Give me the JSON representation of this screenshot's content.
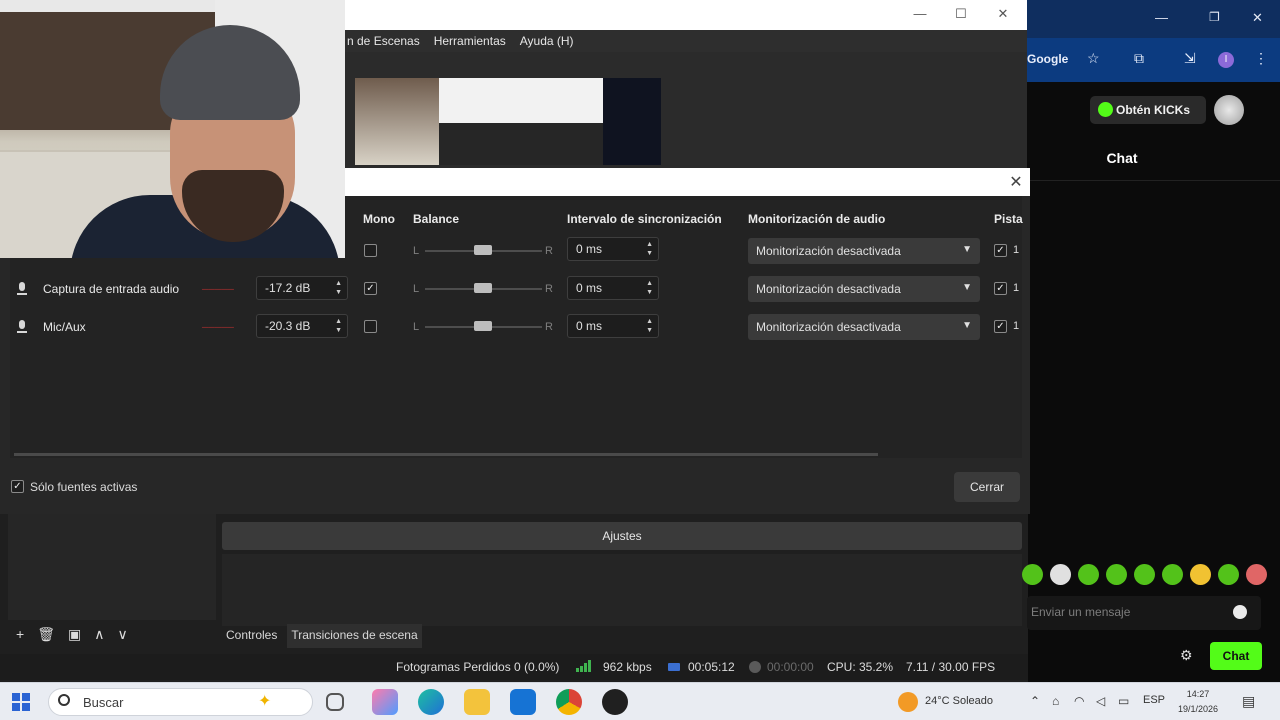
{
  "obs_main": {
    "menu": [
      "n de Escenas",
      "Herramientas",
      "Ayuda (H)"
    ],
    "window_buttons": {
      "minimize": "—",
      "maximize": "☐",
      "close": "✕"
    }
  },
  "dialog": {
    "close_glyph": "✕",
    "columns": {
      "mono": "Mono",
      "balance": "Balance",
      "sync": "Intervalo de sincronización",
      "monitoring": "Monitorización de audio",
      "tracks": "Pista"
    },
    "rows": [
      {
        "name": "",
        "volume": "",
        "mono": false,
        "sync": "0 ms",
        "monitoring": "Monitorización desactivada",
        "track": "1"
      },
      {
        "name": "Captura de entrada audio",
        "volume": "-17.2 dB",
        "mono": true,
        "sync": "0 ms",
        "monitoring": "Monitorización desactivada",
        "track": "1"
      },
      {
        "name": "Mic/Aux",
        "volume": "-20.3 dB",
        "mono": false,
        "sync": "0 ms",
        "monitoring": "Monitorización desactivada",
        "track": "1"
      }
    ],
    "balance_left": "L",
    "balance_right": "R",
    "active_only": "Sólo fuentes activas",
    "close_button": "Cerrar"
  },
  "dock": {
    "ajustes": "Ajustes",
    "tabs": [
      "Controles",
      "Transiciones de escena"
    ],
    "toolbar_icons": [
      "+",
      "🗑",
      "▣",
      "∧",
      "∨"
    ],
    "status": {
      "dropped": "Fotogramas Perdidos 0 (0.0%)",
      "bitrate": "962 kbps",
      "stream_time": "00:05:12",
      "rec_time": "00:00:00",
      "cpu": "CPU: 35.2%",
      "fps": "7.11 / 30.00 FPS"
    }
  },
  "browser": {
    "google": "Google",
    "profile_initial": "I",
    "kicks_button": "Obtén KICKs",
    "chat_title": "Chat",
    "chat_placeholder": "Enviar un mensaje",
    "send_button": "Chat"
  },
  "taskbar": {
    "search_placeholder": "Buscar",
    "weather_temp": "24°C",
    "weather_desc": "Soleado",
    "language": "ESP",
    "time": "14:27",
    "date": "19/1/2026"
  },
  "colors": {
    "kick_green": "#53fc18",
    "obs_bg": "#272727",
    "taskbar": "#e9ecf2"
  }
}
